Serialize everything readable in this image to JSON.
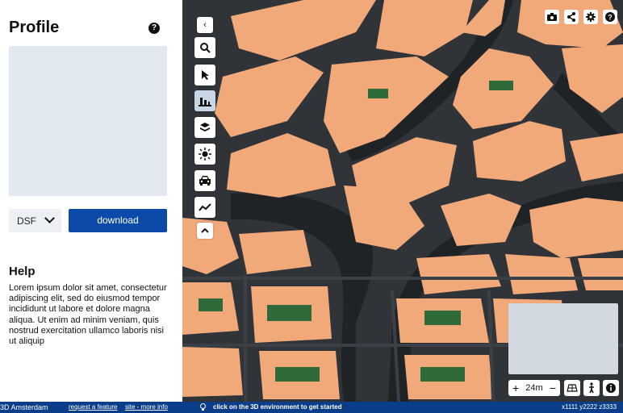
{
  "panel": {
    "title": "Profile",
    "help_icon": "question-icon",
    "format_select": "DSF",
    "download_label": "download",
    "help_title": "Help",
    "help_body": "Lorem ipsum dolor sit amet, consectetur adipiscing elit, sed do eiusmod tempor incididunt ut labore et dolore magna aliqua. Ut enim ad minim veniam, quis nostrud exercitation ullamco laboris nisi ut aliquip"
  },
  "toolbar": {
    "collapse_icon": "chevron-left-icon",
    "tools": [
      "search-icon",
      "pointer-icon",
      "buildings-icon",
      "layers-icon",
      "sun-icon",
      "car-icon",
      "trendline-icon"
    ],
    "expand_icon": "chevron-up-icon"
  },
  "top_actions": [
    "camera-icon",
    "share-icon",
    "gear-icon",
    "question-icon"
  ],
  "map_controls": {
    "zoom_in": "+",
    "zoom_out": "−",
    "scale": "24m",
    "icons": [
      "perspective-icon",
      "pedestrian-icon",
      "info-icon"
    ]
  },
  "footer": {
    "brand": "3D Amsterdam",
    "request_feature": "request a feature",
    "site_info": "site - more info",
    "hint": "click on the 3D environment to get started",
    "coords": "x1111 y2222 z3333"
  },
  "colors": {
    "primary": "#0b4aa8",
    "footer": "#0b3e8a",
    "building": "#f1a97a",
    "water": "#1f2326",
    "park": "#2f6b3a"
  }
}
